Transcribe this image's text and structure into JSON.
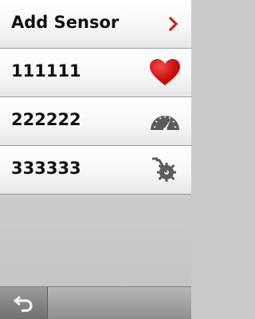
{
  "list": {
    "add_sensor": {
      "label": "Add Sensor",
      "icon": "chevron-right-icon",
      "accent": "#cc1f1f"
    },
    "items": [
      {
        "label": "111111",
        "icon": "heart-icon",
        "color": "#d11a1a"
      },
      {
        "label": "222222",
        "icon": "speedometer-icon",
        "color": "#5a5a5a"
      },
      {
        "label": "333333",
        "icon": "bike-cadence-gear-icon",
        "color": "#5a5a5a"
      }
    ]
  },
  "bottom_bar": {
    "back_icon": "back-arrow-icon"
  }
}
